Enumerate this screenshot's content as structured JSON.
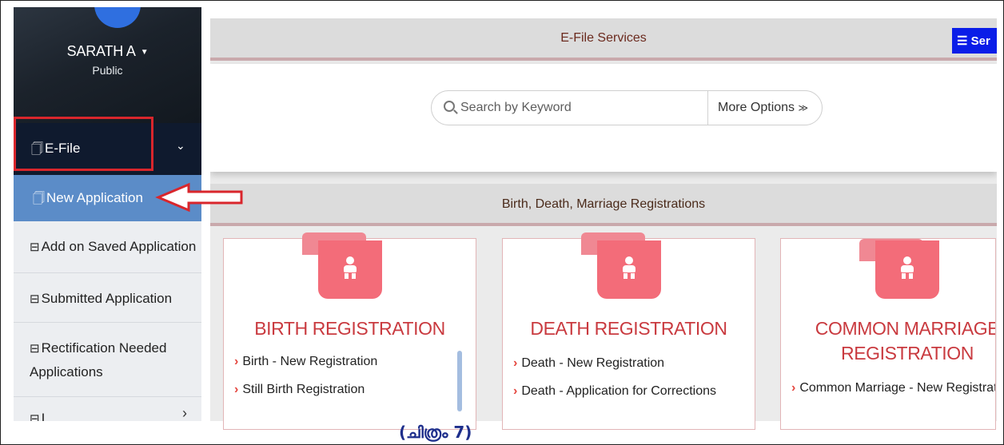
{
  "sidebar": {
    "user": {
      "name": "SARATH A",
      "role": "Public"
    },
    "efile": {
      "label": "E-File"
    },
    "items": [
      {
        "label": "New Application"
      },
      {
        "label": "Add on Saved Application"
      },
      {
        "label": "Submitted Application"
      },
      {
        "label_line1": "Rectification Needed",
        "label_line2": "Applications"
      }
    ],
    "partial_label": "I"
  },
  "header": {
    "title": "E-File Services",
    "services_button": "Ser"
  },
  "search": {
    "placeholder": "Search by Keyword",
    "more_options": "More Options"
  },
  "section": {
    "title": "Birth, Death, Marriage Registrations"
  },
  "cards": [
    {
      "title": "BIRTH REGISTRATION",
      "links": [
        "Birth - New Registration",
        "Still Birth Registration"
      ]
    },
    {
      "title": "DEATH REGISTRATION",
      "links": [
        "Death - New Registration",
        "Death - Application for Corrections"
      ]
    },
    {
      "title_line1": "COMMON MARRIAGE",
      "title_line2": "REGISTRATION",
      "links": [
        "Common Marriage - New Registrati"
      ]
    }
  ],
  "caption": "(ചിത്രം 7)",
  "colors": {
    "highlight_box": "#d9262c",
    "active_item": "#5b8cc8",
    "card_title": "#c93a3f",
    "badge": "#f36c79"
  },
  "icons": [
    "file-icon",
    "chevron-down-icon",
    "briefcase-icon",
    "chevron-right-icon",
    "search-icon",
    "double-chevron-down-icon",
    "list-icon",
    "baby-icon",
    "arrow-left-icon"
  ]
}
